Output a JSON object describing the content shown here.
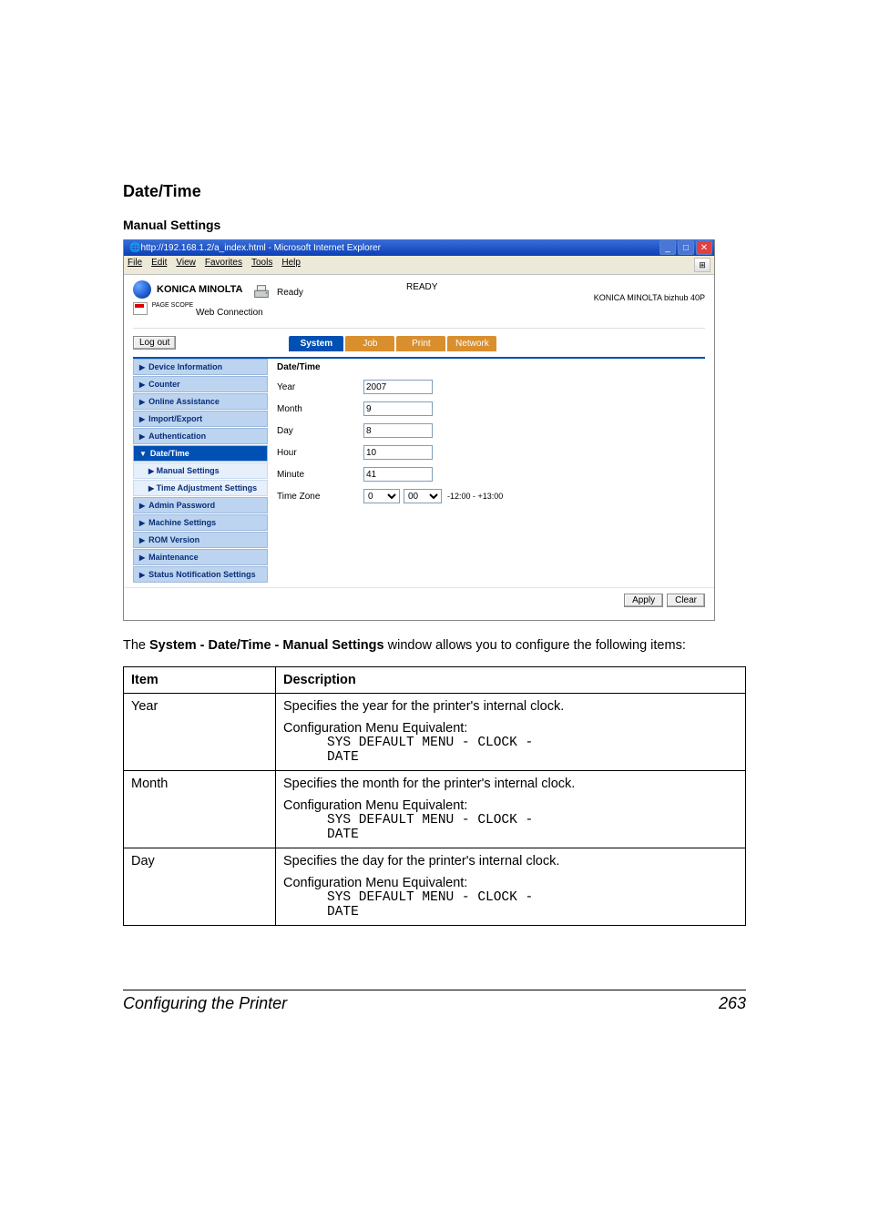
{
  "headings": {
    "main": "Date/Time",
    "sub": "Manual Settings"
  },
  "screenshot": {
    "titlebar": "http://192.168.1.2/a_index.html - Microsoft Internet Explorer",
    "menus": [
      "File",
      "Edit",
      "View",
      "Favorites",
      "Tools",
      "Help"
    ],
    "brand": "KONICA MINOLTA",
    "pagescope_label": "Web Connection",
    "pagescope_prefix": "PAGE SCOPE",
    "status_word": "Ready",
    "ready_label": "READY",
    "device_name": "KONICA MINOLTA bizhub 40P",
    "logout": "Log out",
    "tabs": {
      "system": "System",
      "job": "Job",
      "print": "Print",
      "network": "Network"
    },
    "sidebar": {
      "device_info": "Device Information",
      "counter": "Counter",
      "online_assist": "Online Assistance",
      "import_export": "Import/Export",
      "authentication": "Authentication",
      "date_time": "Date/Time",
      "manual_settings": "Manual Settings",
      "time_adjust": "Time Adjustment Settings",
      "admin_password": "Admin Password",
      "machine_settings": "Machine Settings",
      "rom_version": "ROM Version",
      "maintenance": "Maintenance",
      "status_notification": "Status Notification Settings"
    },
    "panel": {
      "title": "Date/Time",
      "year_label": "Year",
      "year_value": "2007",
      "month_label": "Month",
      "month_value": "9",
      "day_label": "Day",
      "day_value": "8",
      "hour_label": "Hour",
      "hour_value": "10",
      "minute_label": "Minute",
      "minute_value": "41",
      "timezone_label": "Time Zone",
      "tz_hour": "0",
      "tz_min": "00",
      "tz_range": "-12:00 - +13:00"
    },
    "footer": {
      "apply": "Apply",
      "clear": "Clear"
    }
  },
  "intro_prefix": "The ",
  "intro_bold": "System - Date/Time - Manual Settings",
  "intro_suffix": " window allows you to configure the following items:",
  "table": {
    "head_item": "Item",
    "head_desc": "Description",
    "cfg_label": "Configuration Menu Equivalent:",
    "cfg_path_line1": "SYS DEFAULT MENU - CLOCK -",
    "cfg_path_line2": "DATE",
    "rows": [
      {
        "item": "Year",
        "desc": "Specifies the year for the printer's internal clock."
      },
      {
        "item": "Month",
        "desc": "Specifies the month for the printer's internal clock."
      },
      {
        "item": "Day",
        "desc": "Specifies the day for the printer's internal clock."
      }
    ]
  },
  "footer": {
    "title": "Configuring the Printer",
    "page": "263"
  }
}
